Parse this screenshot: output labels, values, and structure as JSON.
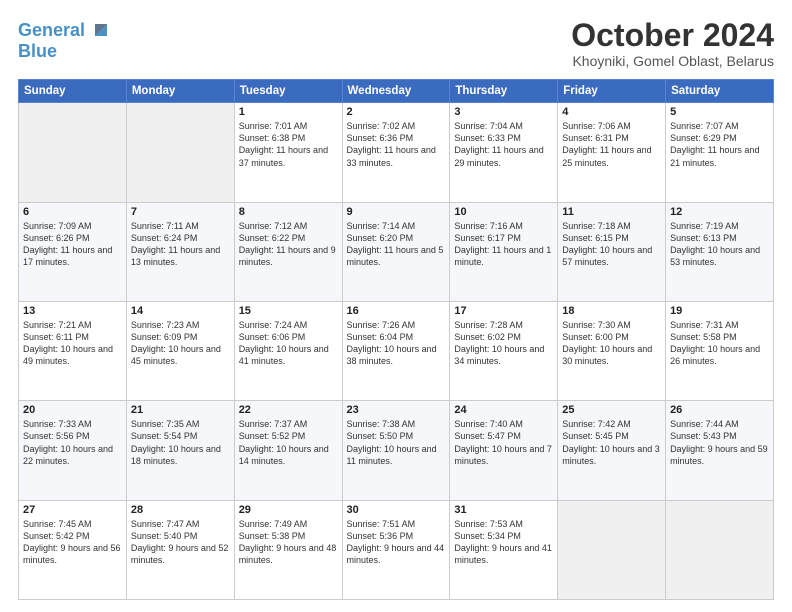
{
  "logo": {
    "line1": "General",
    "line2": "Blue"
  },
  "title": "October 2024",
  "location": "Khoyniki, Gomel Oblast, Belarus",
  "days_of_week": [
    "Sunday",
    "Monday",
    "Tuesday",
    "Wednesday",
    "Thursday",
    "Friday",
    "Saturday"
  ],
  "weeks": [
    [
      {
        "day": "",
        "content": ""
      },
      {
        "day": "",
        "content": ""
      },
      {
        "day": "1",
        "content": "Sunrise: 7:01 AM\nSunset: 6:38 PM\nDaylight: 11 hours and 37 minutes."
      },
      {
        "day": "2",
        "content": "Sunrise: 7:02 AM\nSunset: 6:36 PM\nDaylight: 11 hours and 33 minutes."
      },
      {
        "day": "3",
        "content": "Sunrise: 7:04 AM\nSunset: 6:33 PM\nDaylight: 11 hours and 29 minutes."
      },
      {
        "day": "4",
        "content": "Sunrise: 7:06 AM\nSunset: 6:31 PM\nDaylight: 11 hours and 25 minutes."
      },
      {
        "day": "5",
        "content": "Sunrise: 7:07 AM\nSunset: 6:29 PM\nDaylight: 11 hours and 21 minutes."
      }
    ],
    [
      {
        "day": "6",
        "content": "Sunrise: 7:09 AM\nSunset: 6:26 PM\nDaylight: 11 hours and 17 minutes."
      },
      {
        "day": "7",
        "content": "Sunrise: 7:11 AM\nSunset: 6:24 PM\nDaylight: 11 hours and 13 minutes."
      },
      {
        "day": "8",
        "content": "Sunrise: 7:12 AM\nSunset: 6:22 PM\nDaylight: 11 hours and 9 minutes."
      },
      {
        "day": "9",
        "content": "Sunrise: 7:14 AM\nSunset: 6:20 PM\nDaylight: 11 hours and 5 minutes."
      },
      {
        "day": "10",
        "content": "Sunrise: 7:16 AM\nSunset: 6:17 PM\nDaylight: 11 hours and 1 minute."
      },
      {
        "day": "11",
        "content": "Sunrise: 7:18 AM\nSunset: 6:15 PM\nDaylight: 10 hours and 57 minutes."
      },
      {
        "day": "12",
        "content": "Sunrise: 7:19 AM\nSunset: 6:13 PM\nDaylight: 10 hours and 53 minutes."
      }
    ],
    [
      {
        "day": "13",
        "content": "Sunrise: 7:21 AM\nSunset: 6:11 PM\nDaylight: 10 hours and 49 minutes."
      },
      {
        "day": "14",
        "content": "Sunrise: 7:23 AM\nSunset: 6:09 PM\nDaylight: 10 hours and 45 minutes."
      },
      {
        "day": "15",
        "content": "Sunrise: 7:24 AM\nSunset: 6:06 PM\nDaylight: 10 hours and 41 minutes."
      },
      {
        "day": "16",
        "content": "Sunrise: 7:26 AM\nSunset: 6:04 PM\nDaylight: 10 hours and 38 minutes."
      },
      {
        "day": "17",
        "content": "Sunrise: 7:28 AM\nSunset: 6:02 PM\nDaylight: 10 hours and 34 minutes."
      },
      {
        "day": "18",
        "content": "Sunrise: 7:30 AM\nSunset: 6:00 PM\nDaylight: 10 hours and 30 minutes."
      },
      {
        "day": "19",
        "content": "Sunrise: 7:31 AM\nSunset: 5:58 PM\nDaylight: 10 hours and 26 minutes."
      }
    ],
    [
      {
        "day": "20",
        "content": "Sunrise: 7:33 AM\nSunset: 5:56 PM\nDaylight: 10 hours and 22 minutes."
      },
      {
        "day": "21",
        "content": "Sunrise: 7:35 AM\nSunset: 5:54 PM\nDaylight: 10 hours and 18 minutes."
      },
      {
        "day": "22",
        "content": "Sunrise: 7:37 AM\nSunset: 5:52 PM\nDaylight: 10 hours and 14 minutes."
      },
      {
        "day": "23",
        "content": "Sunrise: 7:38 AM\nSunset: 5:50 PM\nDaylight: 10 hours and 11 minutes."
      },
      {
        "day": "24",
        "content": "Sunrise: 7:40 AM\nSunset: 5:47 PM\nDaylight: 10 hours and 7 minutes."
      },
      {
        "day": "25",
        "content": "Sunrise: 7:42 AM\nSunset: 5:45 PM\nDaylight: 10 hours and 3 minutes."
      },
      {
        "day": "26",
        "content": "Sunrise: 7:44 AM\nSunset: 5:43 PM\nDaylight: 9 hours and 59 minutes."
      }
    ],
    [
      {
        "day": "27",
        "content": "Sunrise: 7:45 AM\nSunset: 5:42 PM\nDaylight: 9 hours and 56 minutes."
      },
      {
        "day": "28",
        "content": "Sunrise: 7:47 AM\nSunset: 5:40 PM\nDaylight: 9 hours and 52 minutes."
      },
      {
        "day": "29",
        "content": "Sunrise: 7:49 AM\nSunset: 5:38 PM\nDaylight: 9 hours and 48 minutes."
      },
      {
        "day": "30",
        "content": "Sunrise: 7:51 AM\nSunset: 5:36 PM\nDaylight: 9 hours and 44 minutes."
      },
      {
        "day": "31",
        "content": "Sunrise: 7:53 AM\nSunset: 5:34 PM\nDaylight: 9 hours and 41 minutes."
      },
      {
        "day": "",
        "content": ""
      },
      {
        "day": "",
        "content": ""
      }
    ]
  ]
}
